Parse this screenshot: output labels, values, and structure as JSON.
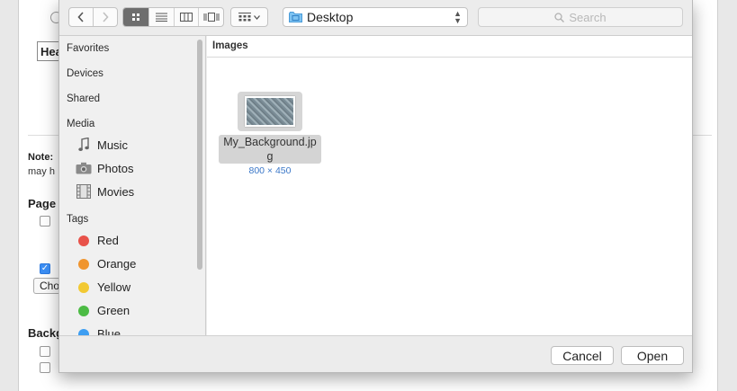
{
  "background": {
    "heading_partial": "Hea",
    "note_label": "Note:",
    "note_text_partial": "may h",
    "page_label_partial": "Page",
    "choose_button_partial": "Cho",
    "background_label_partial": "Backg"
  },
  "dialog": {
    "toolbar": {
      "back_label": "‹",
      "forward_label": "›",
      "location": "Desktop",
      "search_placeholder": "Search"
    },
    "sidebar": {
      "favorites_header": "Favorites",
      "devices_header": "Devices",
      "shared_header": "Shared",
      "media_header": "Media",
      "media_items": [
        {
          "label": "Music",
          "icon": "music-note-icon"
        },
        {
          "label": "Photos",
          "icon": "camera-icon"
        },
        {
          "label": "Movies",
          "icon": "film-icon"
        }
      ],
      "tags_header": "Tags",
      "tags": [
        {
          "label": "Red",
          "color": "#e8524a"
        },
        {
          "label": "Orange",
          "color": "#f0952f"
        },
        {
          "label": "Yellow",
          "color": "#f2c933"
        },
        {
          "label": "Green",
          "color": "#4cbb44"
        },
        {
          "label": "Blue",
          "color": "#3d9ef2"
        }
      ]
    },
    "content": {
      "column_header": "Images",
      "file": {
        "name": "My_Background.jpg",
        "dimensions": "800 × 450"
      }
    },
    "footer": {
      "cancel_label": "Cancel",
      "open_label": "Open"
    }
  }
}
